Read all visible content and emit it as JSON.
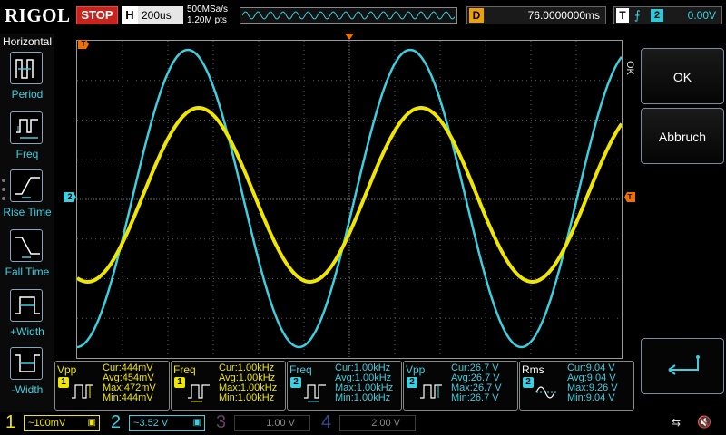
{
  "brand": "RIGOL",
  "run_state": "STOP",
  "timebase": {
    "label": "H",
    "value": "200us"
  },
  "sample": {
    "rate": "500MSa/s",
    "points": "1.20M pts"
  },
  "delay": {
    "label": "D",
    "value": "76.0000000ms"
  },
  "trigger": {
    "label": "T",
    "edge_icon": "rising-edge-icon",
    "edge_glyph": "⨍",
    "source": "2",
    "level": "0.00V"
  },
  "left_menu": {
    "title": "Horizontal",
    "items": [
      {
        "label": "Period",
        "icon": "period-icon"
      },
      {
        "label": "Freq",
        "icon": "frequency-icon"
      },
      {
        "label": "Rise Time",
        "icon": "rise-time-icon"
      },
      {
        "label": "Fall Time",
        "icon": "fall-time-icon"
      },
      {
        "label": "+Width",
        "icon": "positive-width-icon"
      },
      {
        "label": "-Width",
        "icon": "negative-width-icon"
      }
    ]
  },
  "right_menu": {
    "side_label": "OK",
    "ok_label": "OK",
    "cancel_label": "Abbruch"
  },
  "markers": {
    "ch1": "1",
    "ch2": "2",
    "trigger": "T"
  },
  "colors": {
    "ch1": "#f0e600",
    "ch2": "#3ccfe0",
    "ch3": "#c050c0",
    "ch4": "#4a6cff",
    "grid": "#5a5a5a"
  },
  "measurements": [
    {
      "name": "Vpp",
      "channel": "1",
      "color": "yellow",
      "cur": "Cur:444mV",
      "avg": "Avg:454mV",
      "max": "Max:472mV",
      "min": "Min:444mV"
    },
    {
      "name": "Freq",
      "channel": "1",
      "color": "yellow",
      "cur": "Cur:1.00kHz",
      "avg": "Avg:1.00kHz",
      "max": "Max:1.00kHz",
      "min": "Min:1.00kHz"
    },
    {
      "name": "Freq",
      "channel": "2",
      "color": "cyan",
      "cur": "Cur:1.00kHz",
      "avg": "Avg:1.00kHz",
      "max": "Max:1.00kHz",
      "min": "Min:1.00kHz"
    },
    {
      "name": "Vpp",
      "channel": "2",
      "color": "cyan",
      "cur": "Cur:26.7 V",
      "avg": "Avg:26.7 V",
      "max": "Max:26.7 V",
      "min": "Min:26.7 V"
    },
    {
      "name": "Rms",
      "channel": "2",
      "color": "cyan",
      "cur": "Cur:9.04 V",
      "avg": "Avg:9.04 V",
      "max": "Max:9.26 V",
      "min": "Min:9.04 V"
    }
  ],
  "channels": [
    {
      "num": "1",
      "coupling": "~",
      "scale": "100mV",
      "active": true
    },
    {
      "num": "2",
      "coupling": "~",
      "scale": "3.52 V",
      "active": true
    },
    {
      "num": "3",
      "coupling": "",
      "scale": "1.00 V",
      "active": false
    },
    {
      "num": "4",
      "coupling": "",
      "scale": "2.00 V",
      "active": false
    }
  ]
}
